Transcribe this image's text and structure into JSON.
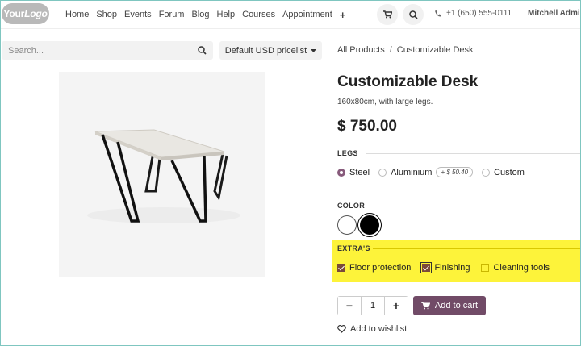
{
  "header": {
    "logo_main": "Your",
    "logo_accent": "Logo",
    "nav": [
      "Home",
      "Shop",
      "Events",
      "Forum",
      "Blog",
      "Help",
      "Courses",
      "Appointment"
    ],
    "plus": "+",
    "phone": "+1 (650) 555-0111",
    "user": "Mitchell Admin"
  },
  "search": {
    "placeholder": "Search..."
  },
  "pricelist": {
    "label": "Default USD pricelist"
  },
  "breadcrumb": {
    "root": "All Products",
    "sep": "/",
    "current": "Customizable Desk"
  },
  "product": {
    "title": "Customizable Desk",
    "subtitle": "160x80cm, with large legs.",
    "price": "$ 750.00"
  },
  "legs": {
    "label": "LEGS",
    "options": [
      {
        "label": "Steel",
        "selected": true
      },
      {
        "label": "Aluminium",
        "extra": "+ $ 50.40",
        "selected": false
      },
      {
        "label": "Custom",
        "selected": false
      }
    ]
  },
  "color": {
    "label": "COLOR",
    "swatches": [
      {
        "name": "White",
        "hex": "#ffffff",
        "selected": false
      },
      {
        "name": "Black",
        "hex": "#000000",
        "selected": true
      }
    ]
  },
  "extras": {
    "label": "EXTRA'S",
    "highlight_color": "#fdf33a",
    "options": [
      {
        "label": "Floor protection",
        "checked": true
      },
      {
        "label": "Finishing",
        "checked": true
      },
      {
        "label": "Cleaning tools",
        "checked": false
      }
    ]
  },
  "quantity": {
    "value": "1",
    "minus": "−",
    "plus": "+"
  },
  "cart": {
    "label": "Add to cart",
    "color": "#714b67"
  },
  "wishlist": {
    "label": "Add to wishlist"
  }
}
